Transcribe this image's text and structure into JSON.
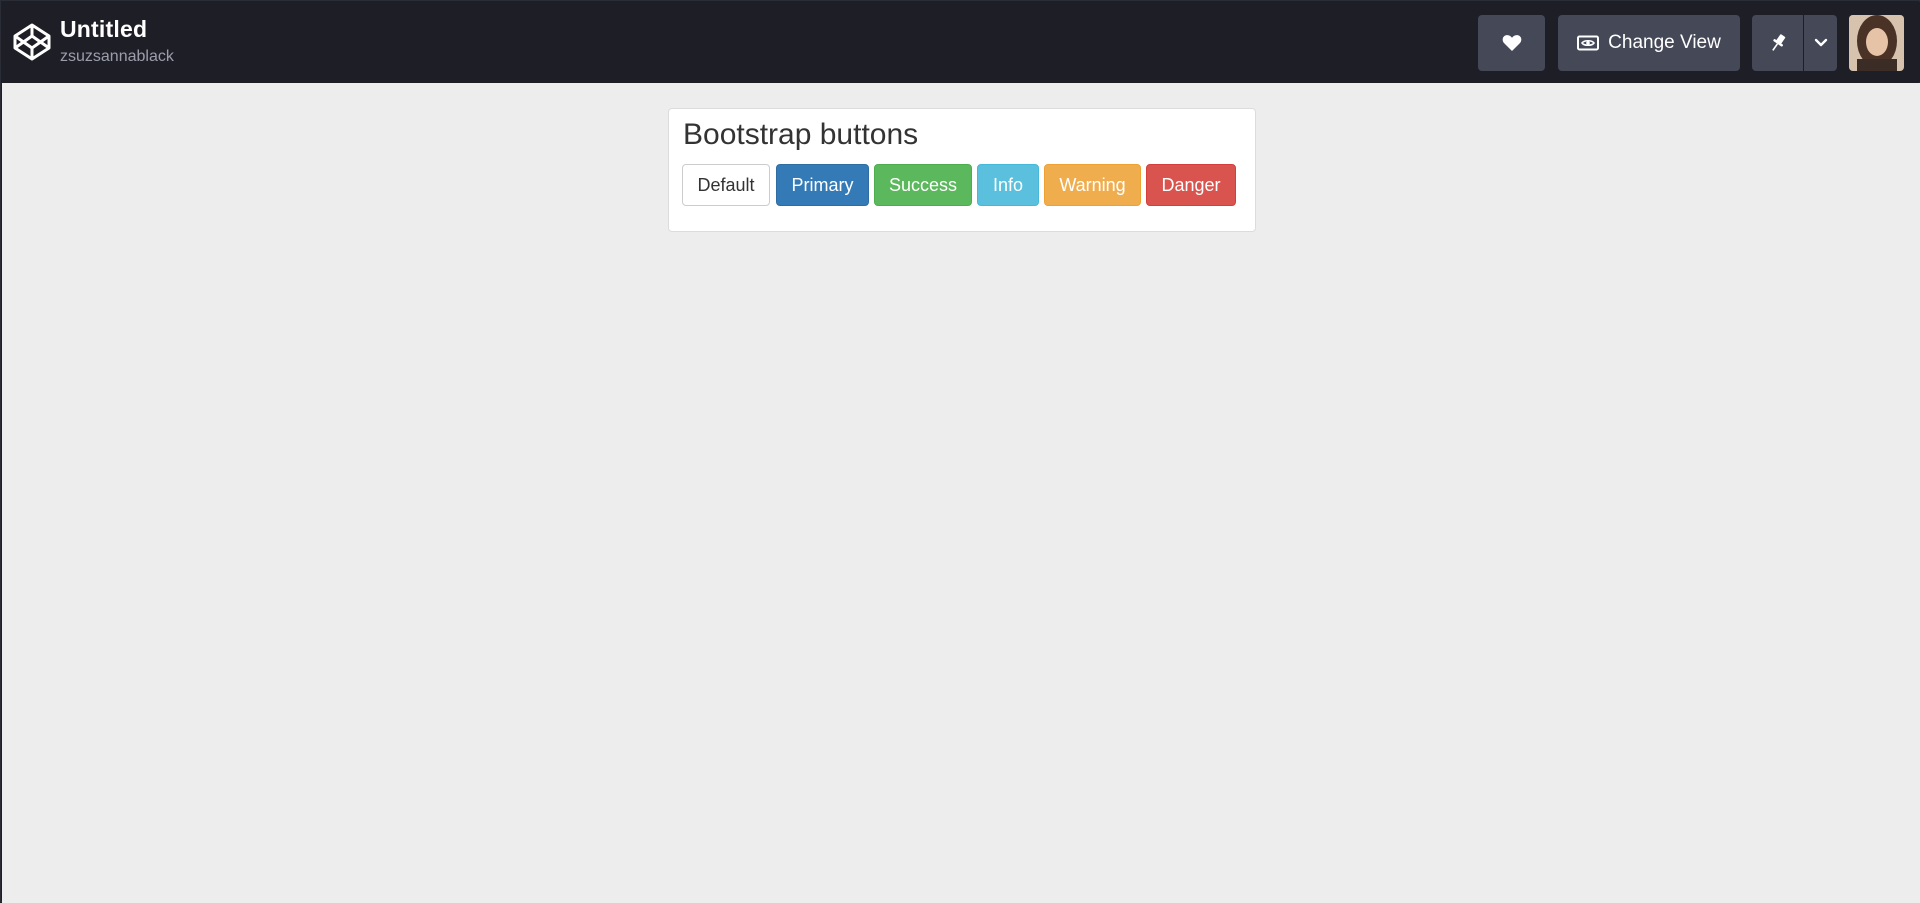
{
  "header": {
    "title": "Untitled",
    "author": "zsuzsannablack",
    "logo_icon": "codepen-logo-icon",
    "heart_icon": "heart-icon",
    "change_view_label": "Change View",
    "change_view_icon": "eye-icon",
    "pin_icon": "pin-icon",
    "caret_icon": "chevron-down-icon",
    "avatar_icon": "user-avatar",
    "colors": {
      "bar": "#1e1f26",
      "button": "#444857"
    }
  },
  "preview": {
    "background": "#ededed",
    "panel": {
      "title": "Bootstrap buttons",
      "buttons": [
        {
          "label": "Default",
          "color": "#ffffff"
        },
        {
          "label": "Primary",
          "color": "#337ab7"
        },
        {
          "label": "Success",
          "color": "#5cb85c"
        },
        {
          "label": "Info",
          "color": "#5bc0de"
        },
        {
          "label": "Warning",
          "color": "#f0ad4e"
        },
        {
          "label": "Danger",
          "color": "#d9534f"
        }
      ]
    }
  }
}
